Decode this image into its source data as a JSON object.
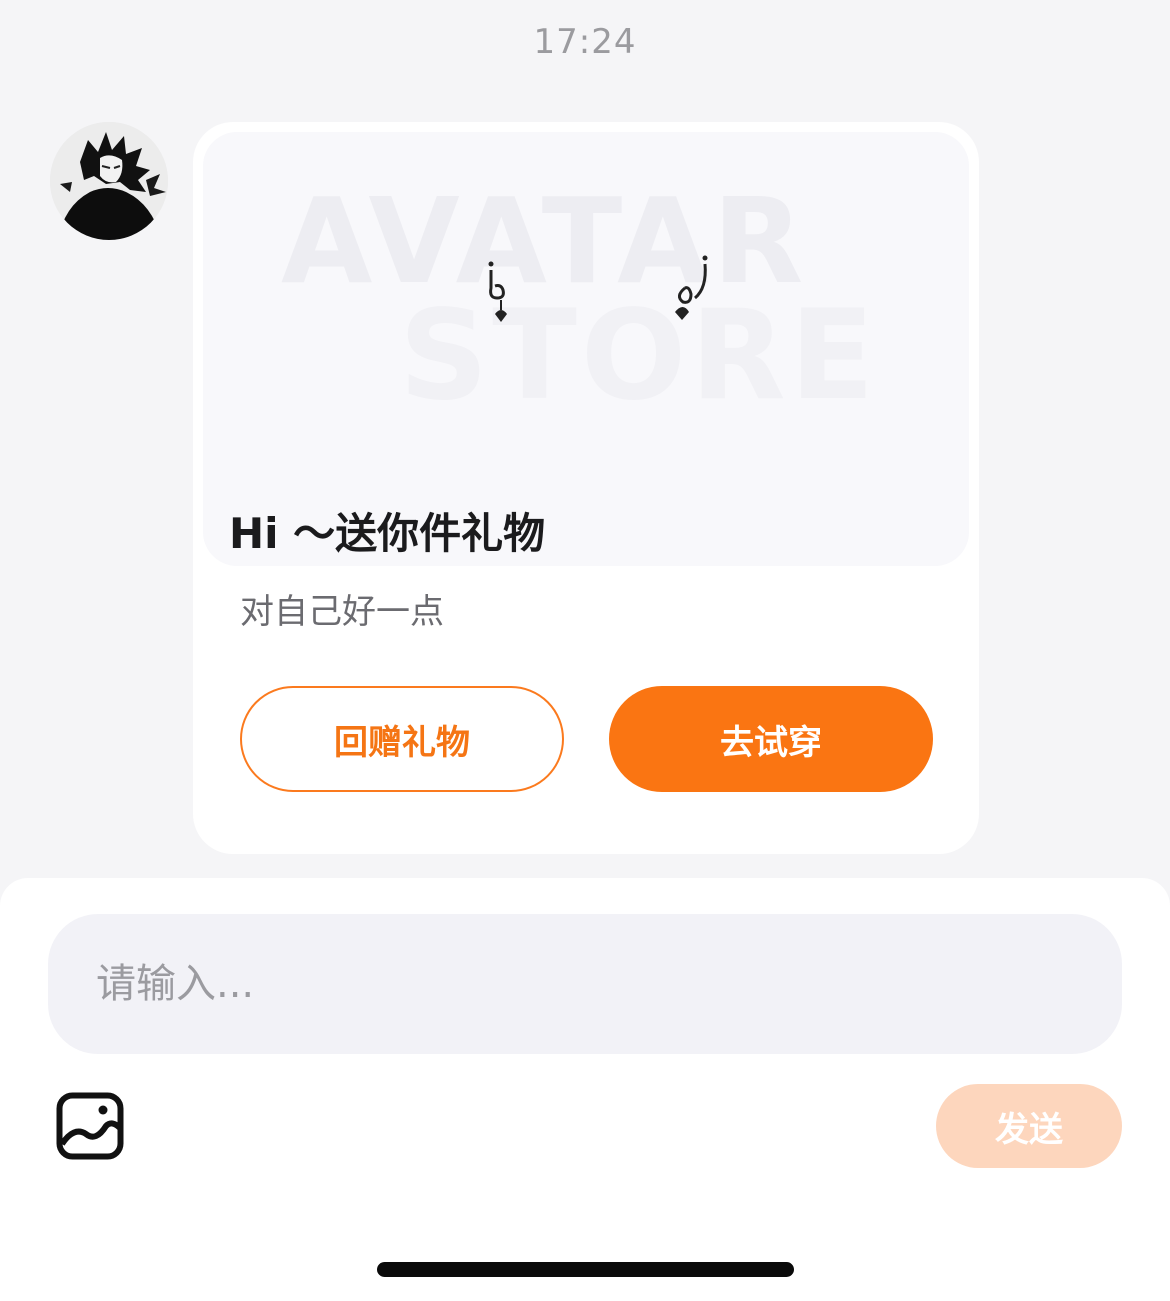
{
  "chat": {
    "timestamp": "17:24"
  },
  "gift_card": {
    "watermark_line1": "AVATAR",
    "watermark_line2": "STORE",
    "title": "Hi ～送你件礼物",
    "subtitle": "对自己好一点",
    "return_gift_label": "回赠礼物",
    "try_on_label": "去试穿"
  },
  "composer": {
    "placeholder": "请输入...",
    "send_label": "发送",
    "image_icon": "image-icon"
  },
  "colors": {
    "accent": "#fa7512",
    "accent_light": "#fdd6bd",
    "background": "#f5f5f7",
    "card": "#ffffff",
    "input_bg": "#f2f2f7"
  }
}
